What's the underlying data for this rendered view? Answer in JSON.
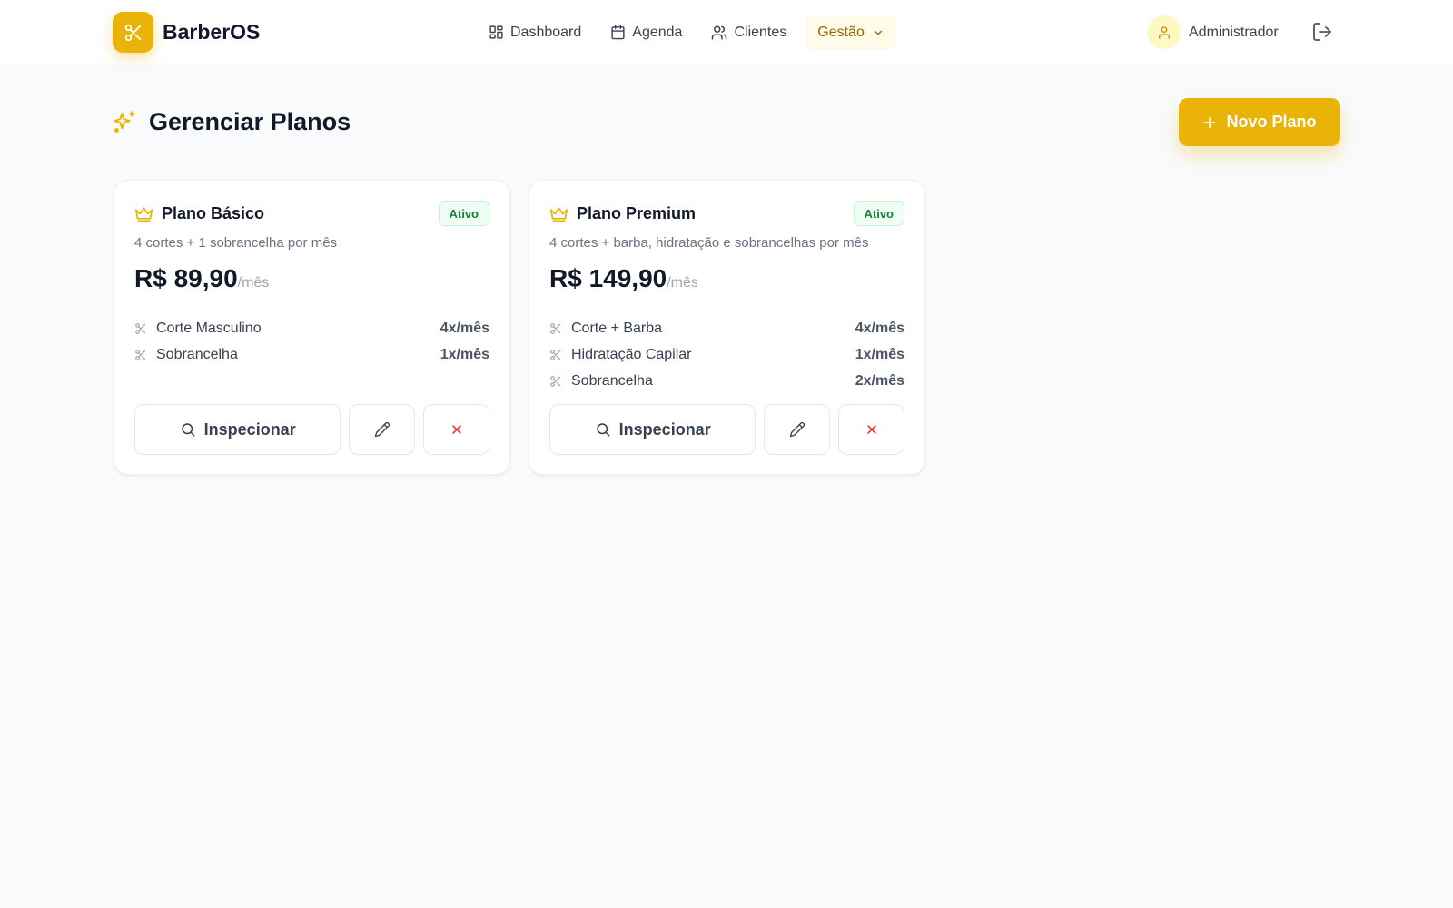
{
  "app": {
    "name": "BarberOS",
    "accent": "#eab308"
  },
  "nav": {
    "items": [
      {
        "label": "Dashboard",
        "icon": "dashboard-icon"
      },
      {
        "label": "Agenda",
        "icon": "calendar-icon"
      },
      {
        "label": "Clientes",
        "icon": "users-icon"
      },
      {
        "label": "Gestão",
        "icon": "chevron-down-icon",
        "active": true
      }
    ]
  },
  "user": {
    "name": "Administrador"
  },
  "page": {
    "title": "Gerenciar Planos",
    "new_plan_label": "Novo Plano"
  },
  "plans": [
    {
      "name": "Plano Básico",
      "status": "Ativo",
      "description": "4 cortes + 1 sobrancelha por mês",
      "price": "R$ 89,90",
      "price_unit": "/mês",
      "services": [
        {
          "name": "Corte Masculino",
          "qty": "4x/mês"
        },
        {
          "name": "Sobrancelha",
          "qty": "1x/mês"
        }
      ],
      "inspect_label": "Inspecionar"
    },
    {
      "name": "Plano Premium",
      "status": "Ativo",
      "description": "4 cortes + barba, hidratação e sobrancelhas por mês",
      "price": "R$ 149,90",
      "price_unit": "/mês",
      "services": [
        {
          "name": "Corte + Barba",
          "qty": "4x/mês"
        },
        {
          "name": "Hidratação Capilar",
          "qty": "1x/mês"
        },
        {
          "name": "Sobrancelha",
          "qty": "2x/mês"
        }
      ],
      "inspect_label": "Inspecionar"
    }
  ]
}
